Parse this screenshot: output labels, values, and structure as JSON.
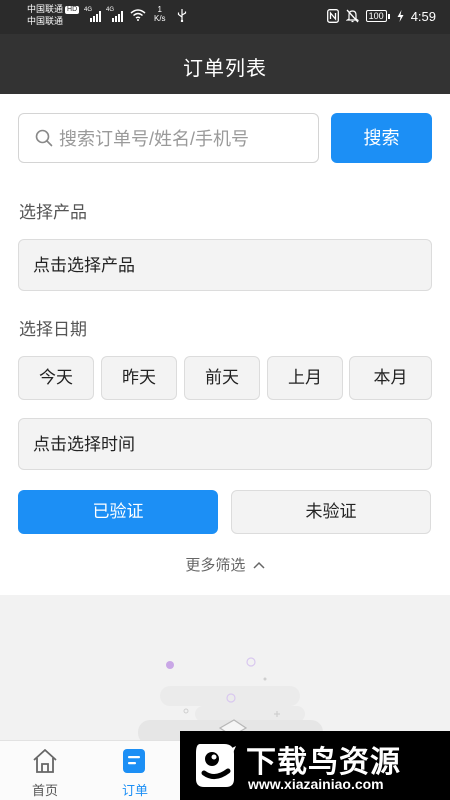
{
  "status_bar": {
    "carrier_1": "中国联通",
    "carrier_1_badge": "HD",
    "carrier_2": "中国联通",
    "network_1": "4G",
    "network_2": "4G",
    "speed_value": "1",
    "speed_unit": "K/s",
    "battery": "100",
    "time": "4:59"
  },
  "header": {
    "title": "订单列表"
  },
  "search": {
    "placeholder": "搜索订单号/姓名/手机号",
    "value": "",
    "button_label": "搜索"
  },
  "product": {
    "section_label": "选择产品",
    "placeholder": "点击选择产品"
  },
  "date": {
    "section_label": "选择日期",
    "quick_options": [
      "今天",
      "昨天",
      "前天",
      "上月",
      "本月"
    ],
    "time_placeholder": "点击选择时间"
  },
  "verification": {
    "verified_label": "已验证",
    "unverified_label": "未验证",
    "selected": "已验证"
  },
  "more_filters": {
    "label": "更多筛选"
  },
  "tab_bar": {
    "items": [
      {
        "label": "首页",
        "icon": "home-icon",
        "active": false
      },
      {
        "label": "订单",
        "icon": "order-icon",
        "active": true
      }
    ]
  },
  "watermark": {
    "title": "下载鸟资源",
    "url": "www.xiazainiao.com"
  },
  "colors": {
    "accent": "#1c8ff5",
    "header_bg": "#333333",
    "status_bg": "#2b2b2b"
  }
}
